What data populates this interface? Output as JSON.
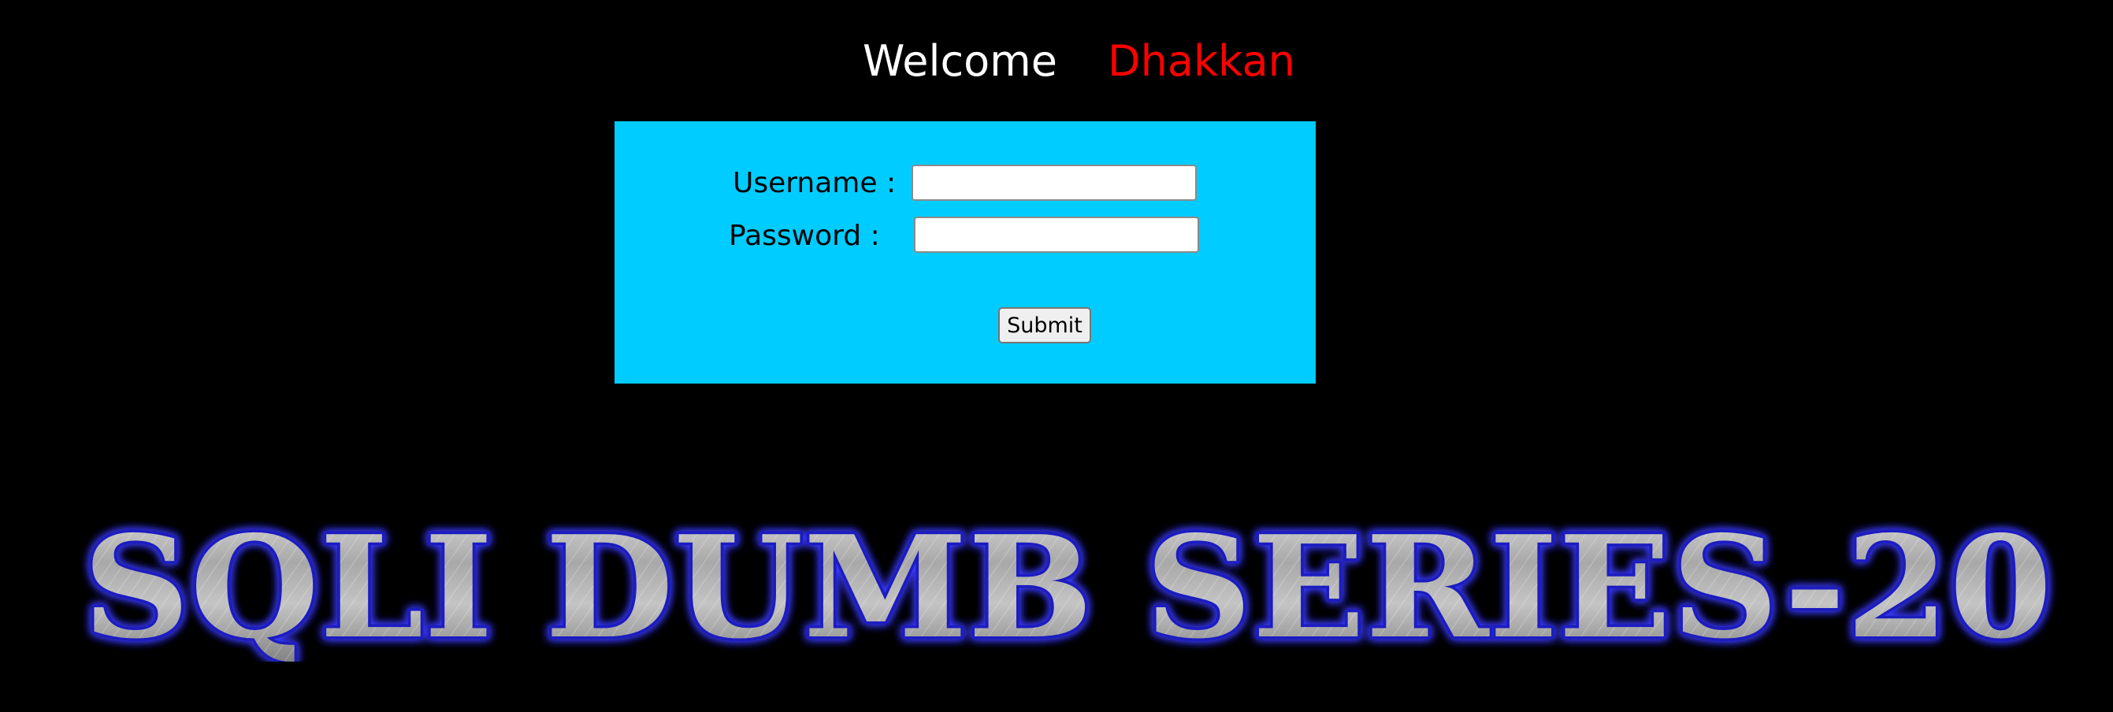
{
  "header": {
    "welcome_text": "Welcome",
    "user_name": "Dhakkan"
  },
  "login_form": {
    "username_label": "Username :",
    "password_label": "Password :",
    "username_value": "",
    "password_value": "",
    "submit_label": "Submit"
  },
  "banner": {
    "title_image_text": "SQLI DUMB SERIES-20"
  },
  "colors": {
    "page_background": "#000000",
    "form_background": "#00ccff",
    "welcome_color": "#ffffff",
    "user_name_color": "#ff0000",
    "banner_glow": "#3333ff"
  }
}
